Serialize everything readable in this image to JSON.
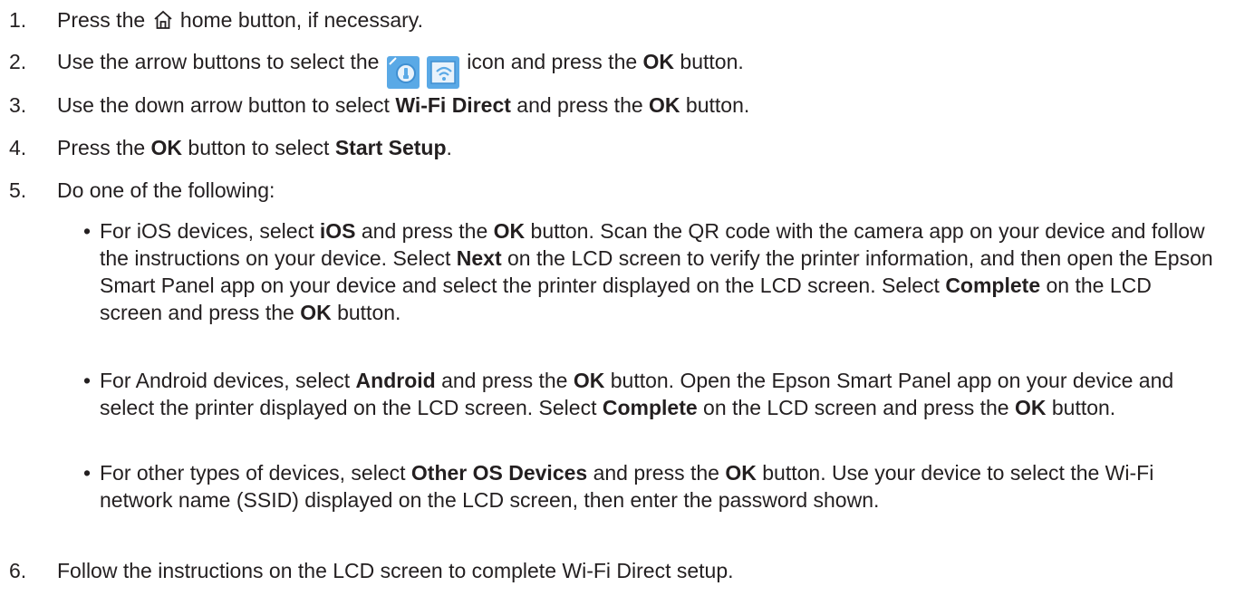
{
  "steps": [
    {
      "num": "1.",
      "a": "Press the ",
      "b": " home button, if necessary."
    },
    {
      "num": "2.",
      "a": "Use the arrow buttons to select the ",
      "b": " icon and press the ",
      "c": "OK",
      "d": " button."
    },
    {
      "num": "3.",
      "a": "Use the down arrow button to select ",
      "b": "Wi-Fi Direct",
      "c": " and press the ",
      "d": "OK",
      "e": " button."
    },
    {
      "num": "4.",
      "a": "Press the ",
      "b": "OK",
      "c": " button to select ",
      "d": "Start Setup",
      "e": "."
    },
    {
      "num": "5.",
      "a": "Do one of the following:"
    },
    {
      "num": "6.",
      "a": "Follow the instructions on the LCD screen to complete Wi-Fi Direct setup."
    }
  ],
  "bullet_dot": "•",
  "bullets": [
    {
      "t1": "For iOS devices, select ",
      "b1": "iOS",
      "t2": " and press the ",
      "b2": "OK",
      "t3": " button. Scan the QR code with the camera app on your device and follow the instructions on your device. Select ",
      "b3": "Next",
      "t4": " on the LCD screen to verify the printer information, and then open the Epson Smart Panel app on your device and select the printer displayed on the LCD screen. Select ",
      "b4": "Complete",
      "t5": " on the LCD screen and press the ",
      "b5": "OK",
      "t6": " button."
    },
    {
      "t1": "For Android devices, select ",
      "b1": "Android",
      "t2": " and press the ",
      "b2": "OK",
      "t3": " button. Open the Epson Smart Panel app on your device and select the printer displayed on the LCD screen. Select ",
      "b3": "Complete",
      "t4": " on the LCD screen and press the ",
      "b4": "OK",
      "t5": " button."
    },
    {
      "t1": "For other types of devices, select ",
      "b1": "Other OS Devices",
      "t2": " and press the ",
      "b2": "OK",
      "t3": " button. Use your device to select the Wi-Fi network name (SSID) displayed on the LCD screen, then enter the password shown."
    }
  ],
  "colors": {
    "text": "#231f20",
    "icon_blue": "#5aa9e6",
    "icon_light": "#e8f2fb"
  },
  "icons": [
    "home-icon",
    "wifi-setup-icon",
    "wifi-icon"
  ]
}
